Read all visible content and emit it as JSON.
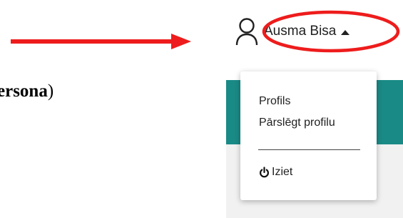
{
  "document": {
    "text_bold": "ersona",
    "text_after": ")"
  },
  "user_menu": {
    "name": "Ausma Bisa",
    "icon": "user-icon",
    "caret_icon": "caret-up-icon"
  },
  "dropdown": {
    "items": [
      {
        "label": "Profils"
      },
      {
        "label": "Pārslēgt profilu"
      }
    ],
    "logout": {
      "label": "Iziet",
      "icon": "power-icon"
    }
  },
  "annotations": {
    "arrow_color": "#ee1c1c",
    "highlight_color": "#ee1c1c"
  },
  "colors": {
    "teal": "#1a8a86",
    "panel_bg": "#f1f1f1"
  }
}
